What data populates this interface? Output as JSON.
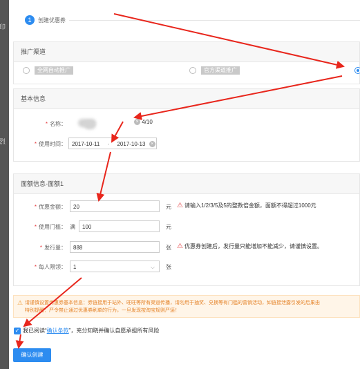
{
  "left_strip": {
    "text_a": "印",
    "text_b": "烈"
  },
  "step": {
    "number": "1",
    "label": "创建优惠券"
  },
  "channel": {
    "title": "推广渠道",
    "option_1": "全网自动推广",
    "option_2": "官方渠道推广"
  },
  "basic": {
    "title": "基本信息",
    "name_label": "名称：",
    "name_count": "4/10",
    "time_label": "使用时间：",
    "start_date": "2017-10-11",
    "date_sep": "-",
    "end_date": "2017-10-13",
    "required_mark": "*"
  },
  "denomination": {
    "title": "面额信息-面额1",
    "amount_label": "优惠金额：",
    "amount_value": "20",
    "amount_unit": "元",
    "amount_warning": "请输入1/2/3/5及5的整数倍金额，面额不得超过1000元",
    "threshold_label": "使用门槛：",
    "threshold_prefix": "满",
    "threshold_value": "100",
    "threshold_unit": "元",
    "issue_label": "发行量：",
    "issue_value": "888",
    "issue_unit": "张",
    "issue_warning": "优惠券创建后，发行量只能增加不能减少，请谨慎设置。",
    "limit_label": "每人限领：",
    "limit_value": "1",
    "limit_unit": "张"
  },
  "notice": {
    "line1": "请谨慎设置优惠券基本信息：券链接用于站外、旺旺等所有渠道传播，请勿用于抽奖、兑换等有门槛的营销活动，如链接泄露引发的后果由",
    "line2": "特别提醒：严令禁止通过优惠券刷单的行为，一旦发现按淘宝规则严惩！"
  },
  "agreement": {
    "prefix": "我已阅读“",
    "link": "确认条款",
    "suffix": "”，充分知晓并确认自愿承担所有风险"
  },
  "confirm_button": "确认创建"
}
